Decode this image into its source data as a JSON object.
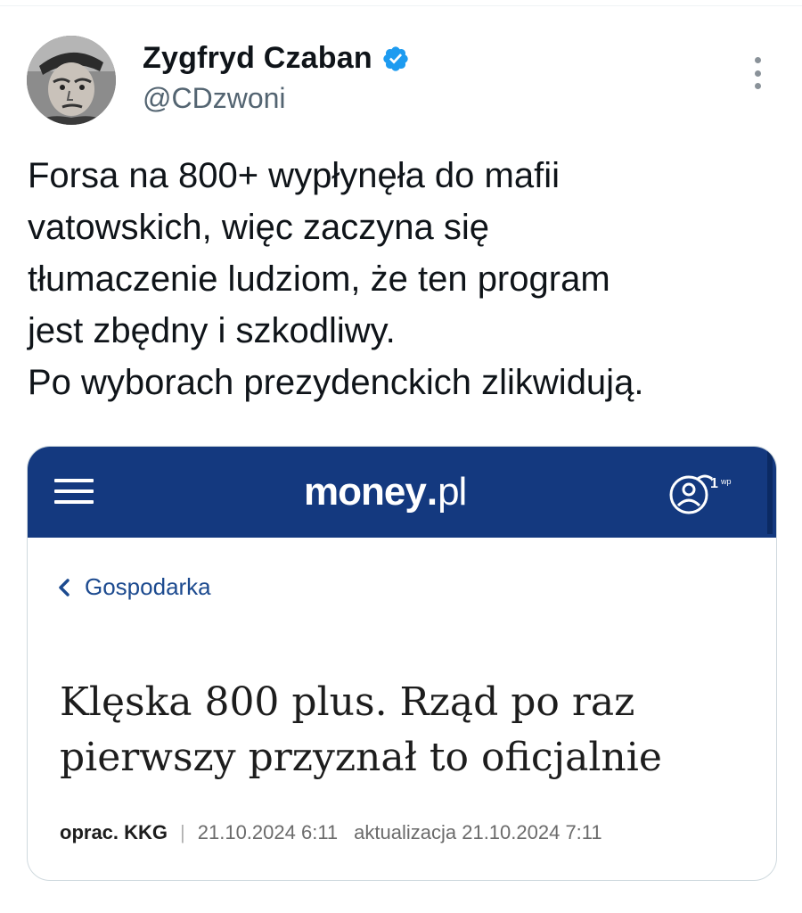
{
  "tweet": {
    "author": {
      "display_name": "Zygfryd Czaban",
      "handle": "@CDzwoni",
      "verified": true,
      "verified_color": "#1d9bf0"
    },
    "text_lines": [
      "Forsa na 800+ wypłynęła do mafii",
      "vatowskich, więc zaczyna się",
      "tłumaczenie ludziom, że ten program",
      "jest zbędny i szkodliwy.",
      "Po wyborach prezydenckich zlikwidują."
    ],
    "more_icon": "more-vertical-icon"
  },
  "embedded_article": {
    "header": {
      "brand_color": "#14397f",
      "logo_word": "money",
      "logo_dot": ".",
      "logo_tld": "pl",
      "menu_icon": "hamburger-icon",
      "account_icon": "account-icon",
      "account_badge": "1"
    },
    "breadcrumb": "Gospodarka",
    "headline_lines": [
      "Klęska 800 plus. Rząd po raz",
      "pierwszy przyznał to oficjalnie"
    ],
    "meta": {
      "author": "oprac. KKG",
      "separator": "|",
      "published": "21.10.2024 6:11",
      "updated": "aktualizacja 21.10.2024 7:11"
    }
  }
}
